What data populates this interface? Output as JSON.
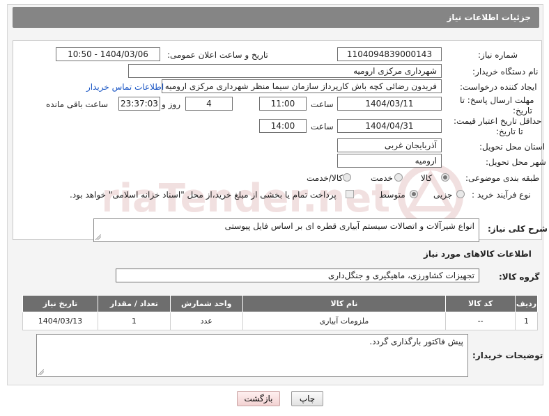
{
  "header": {
    "title": "جزئیات اطلاعات نیاز"
  },
  "fields": {
    "need_number_label": "شماره نیاز:",
    "need_number": "1104094839000143",
    "announce_label": "تاریخ و ساعت اعلان عمومی:",
    "announce_value": "1404/03/06 - 10:50",
    "buyer_label": "نام دستگاه خریدار:",
    "buyer_value": "شهرداری مرکزی ارومیه",
    "creator_label": "ایجاد کننده درخواست:",
    "creator_value": "فریدون رضائی کچه باش کارپرداز سازمان سیما منظر شهرداری مرکزی ارومیه",
    "contact_link": "اطلاعات تماس خریدار",
    "deadline_label_1": "مهلت ارسال پاسخ: تا",
    "deadline_label_2": "تاریخ:",
    "deadline_date": "1404/03/11",
    "time_label": "ساعت",
    "deadline_time": "11:00",
    "days_value": "4",
    "days_label": "روز و",
    "remaining_time": "23:37:03",
    "remaining_label": "ساعت باقی مانده",
    "validity_label_1": "حداقل تاریخ اعتبار قیمت:",
    "validity_label_2": "تا تاریخ:",
    "validity_date": "1404/04/31",
    "validity_time_label": "ساعت",
    "validity_time": "14:00",
    "province_label": "استان محل تحویل:",
    "province_value": "آذربایجان غربی",
    "city_label": "شهر محل تحویل:",
    "city_value": "ارومیه",
    "category_label": "طبقه بندی موضوعی:",
    "category_options": [
      "کالا",
      "خدمت",
      "کالا/خدمت"
    ],
    "process_label": "نوع فرآیند خرید :",
    "process_options": [
      "جزیی",
      "متوسط"
    ],
    "payment_note": "پرداخت تمام یا بخشی از مبلغ خرید،از محل \"اسناد خزانه اسلامی\" خواهد بود."
  },
  "description": {
    "label": "شرح کلی نیاز:",
    "value": "انواع شیرآلات و  اتصالات سیستم آبیاری قطره ای بر اساس فایل پیوستی"
  },
  "goods": {
    "section_title": "اطلاعات کالاهای مورد نیاز",
    "group_label": "گروه کالا:",
    "group_value": "تجهیزات کشاورزی، ماهیگیری و جنگل‌داری"
  },
  "table": {
    "headers": [
      "ردیف",
      "کد کالا",
      "نام کالا",
      "واحد شمارش",
      "تعداد / مقدار",
      "تاریخ نیاز"
    ],
    "rows": [
      [
        "1",
        "--",
        "ملزومات آبیاری",
        "عدد",
        "1",
        "1404/03/13"
      ]
    ]
  },
  "buyer_notes": {
    "label": "توضیحات خریدار:",
    "value": "پیش فاکتور بارگذاری گردد."
  },
  "buttons": {
    "print": "چاپ",
    "back": "بازگشت"
  },
  "colors": {
    "header_bg": "#858585",
    "table_header_bg": "#6e6e6e",
    "link": "#1a56c4",
    "watermark": "#e7c7c7"
  }
}
